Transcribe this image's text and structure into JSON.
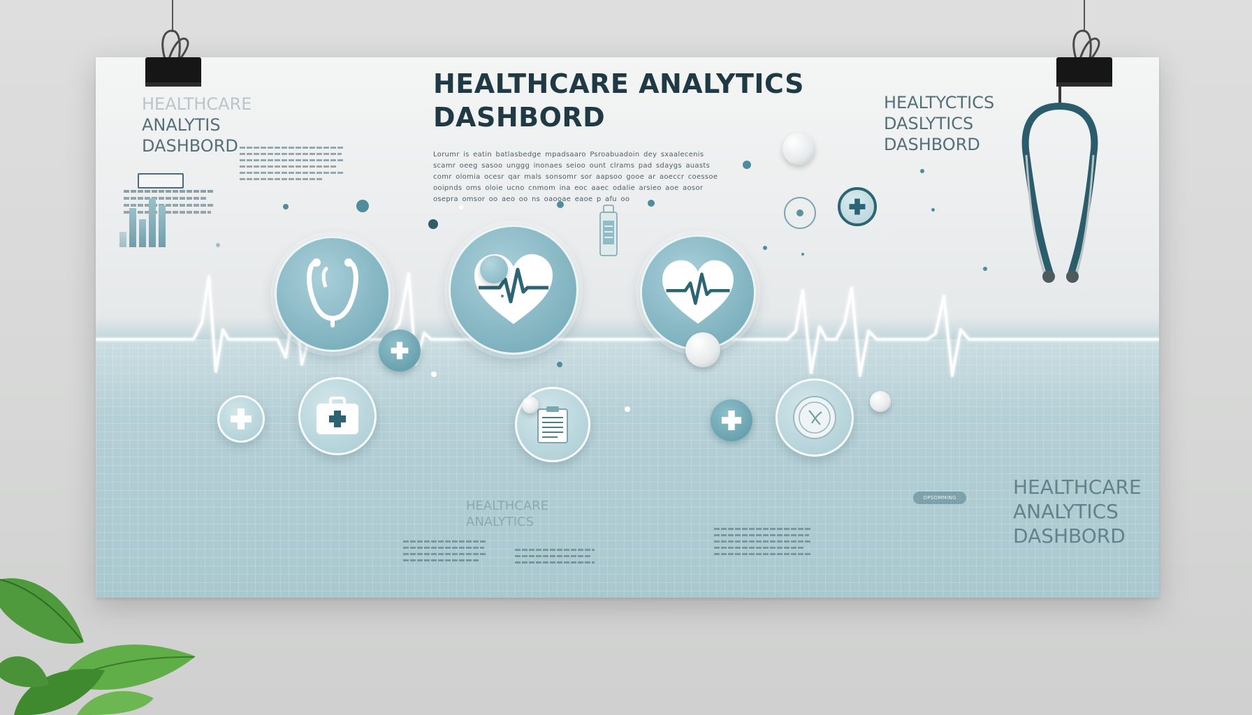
{
  "poster": {
    "title_line1": "HEALTHCARE ANALYTICS",
    "title_line2": "DASHBORD",
    "ghost_top_left": [
      "HEALTHCARE",
      "ANALYTIS",
      "DASHBORD"
    ],
    "ghost_top_right": [
      "HEALTYCTICS",
      "DASLYTICS",
      "DASHBORD"
    ],
    "ghost_bottom_right": [
      "HEALTHCARE",
      "ANALYTICS",
      "DASHBORD"
    ],
    "ghost_bottom_center": [
      "HEALTHCARE",
      "ANALYTICS"
    ],
    "lorem_lines": [
      "Lorumr is eatin batlasbedge mpadsaaro Psroabuadoin dey sxaalecenis",
      "scamr oeeg sasoo unggg inonaes seioo ount clrams pad sdaygs auasts",
      "comr olomia ocesr qar mals sonsomr sor aapsoo gooe ar aoeccr coessoe",
      "ooipnds oms oloie ucno cnmom ina eoc aaec odalie arsieo aoe aosor",
      "osepra omsor oo aeo oo ns oaooae eaoe p afu oo"
    ],
    "badge_text": "OPSOMMING"
  },
  "colors": {
    "title": "#1f3a44",
    "accent_teal": "#7fb2bf",
    "dark_teal": "#2c6474",
    "ecg_line": "#ffffff"
  },
  "icons": [
    "stethoscope-icon",
    "heart-pulse-icon",
    "first-aid-kit-icon",
    "medical-cross-icon",
    "clipboard-icon",
    "medicine-bottle-icon",
    "medical-seal-icon"
  ]
}
